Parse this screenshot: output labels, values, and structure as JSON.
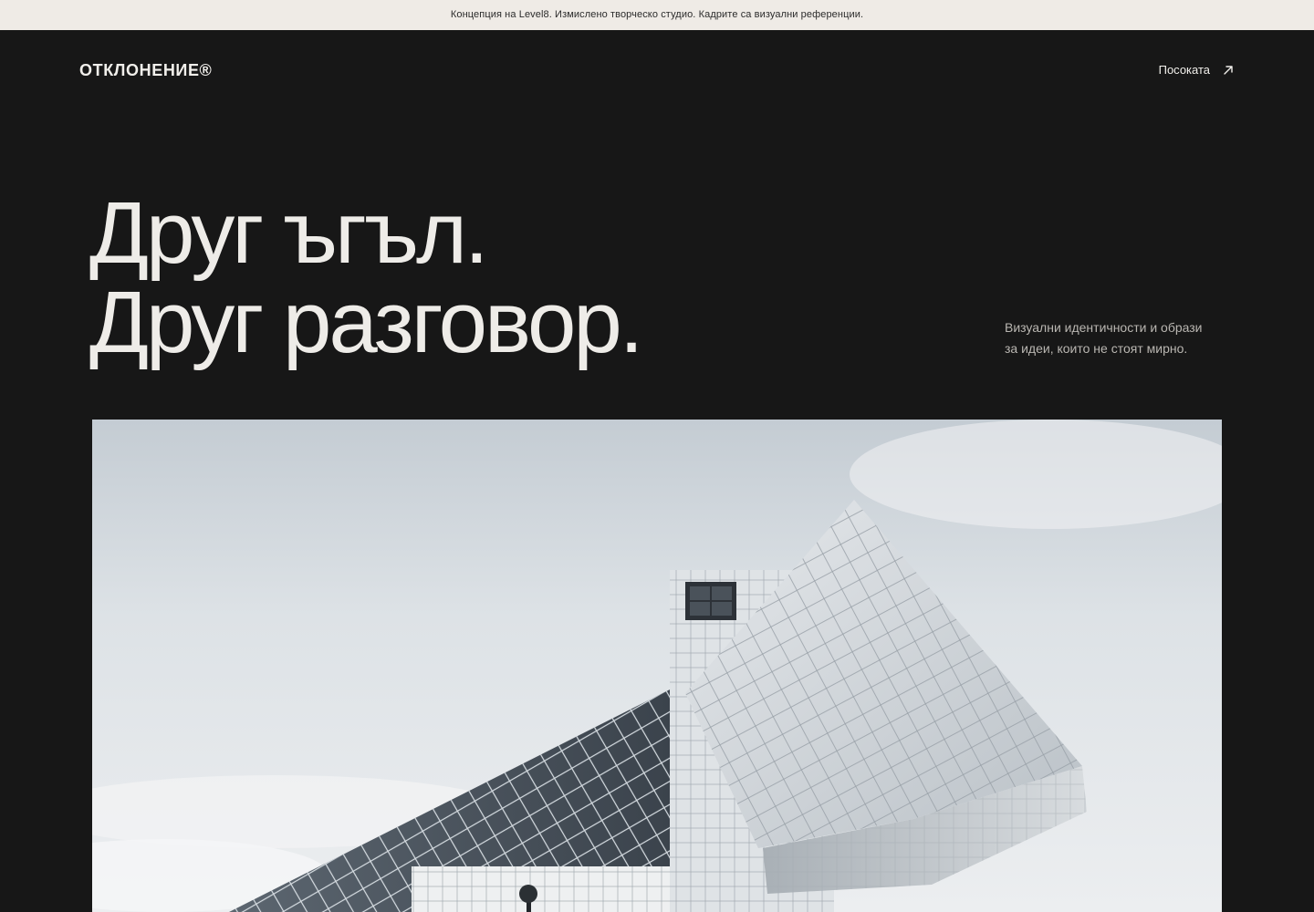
{
  "banner": {
    "text": "Концепция на Level8. Измислено творческо студио. Кадрите са визуални референции."
  },
  "header": {
    "logo": "ОТКЛОНЕНИЕ®",
    "nav_link": "Посоката",
    "nav_icon": "arrow-up-right-icon"
  },
  "hero": {
    "title_line_1": "Друг ъгъл.",
    "title_line_2": "Друг разговор.",
    "subtitle_line_1": "Визуални идентичности и образи",
    "subtitle_line_2": "за идеи, които не стоят мирно.",
    "image_alt": "Модерна сграда с ъглова фасада"
  },
  "colors": {
    "page_background": "#171717",
    "banner_background": "#efebe6",
    "text_light": "#f1efeb",
    "text_muted": "#b9b6b1"
  }
}
